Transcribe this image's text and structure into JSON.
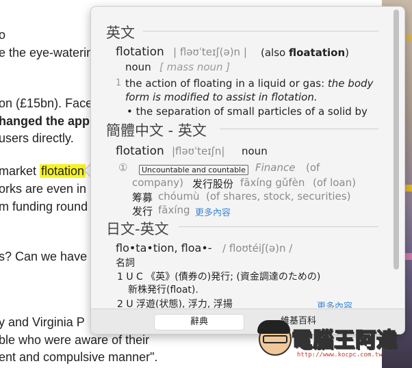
{
  "article": {
    "lines": [
      "o",
      "e the eye-watering",
      "on (£15bn). Face",
      "hanged the app",
      "users directly.",
      "market ",
      "orks are even in",
      "m funding round",
      "s? Can we have",
      "y and Virginia P",
      "ble who were aware of their",
      "ent and compulsive manner\"."
    ],
    "highlighted_word": "flotation"
  },
  "popover": {
    "sections": [
      {
        "heading": "英文",
        "headword": "flotation",
        "pron": "| fləʊˈteɪʃ(ə)n |",
        "also_prefix": "(also ",
        "also_word": "floatation",
        "also_suffix": ")",
        "pos": "noun",
        "mass": "[ mass noun ]",
        "def_num": "1",
        "def_text": "the action of floating in a liquid or gas: ",
        "def_example": "the body",
        "def_example2": "form is modified to assist in flotation.",
        "bullet": "• the separation of small particles of a solid by"
      },
      {
        "heading": "簡體中文 - 英文",
        "headword": "flotation",
        "pron": "|fləʊˈteɪʃn|",
        "pos": "noun",
        "sense_num": "①",
        "badge": "Uncountable and countable",
        "domain": "Finance",
        "l1a": "(of",
        "l2a": "company)",
        "l2b": "发行股份",
        "l2c": "fāxíng gǔfèn",
        "l2d": "(of loan)",
        "l3a": "筹募",
        "l3b": "chóumù",
        "l3c": "(of shares, stock, securities)",
        "l4a": "发行",
        "l4b": "fāxíng",
        "more": "更多內容"
      },
      {
        "heading": "日文-英文",
        "headword": "flo•ta•tion, floa•-",
        "pron": "/ floʊtéiʃ(ə)n /",
        "pos": "名詞",
        "d1": "1  U  C 《英》(債券の)発行; (資金調達のための)",
        "d1b": "新株発行(float).",
        "d2": "2  U 浮遊(状態), 浮力, 浮揚",
        "more": "更多內容"
      }
    ],
    "tabs": [
      "辭典",
      "維基百科"
    ]
  },
  "watermark": {
    "brand": "電腦王阿達",
    "url": "http://www.kocpc.com.tw"
  }
}
